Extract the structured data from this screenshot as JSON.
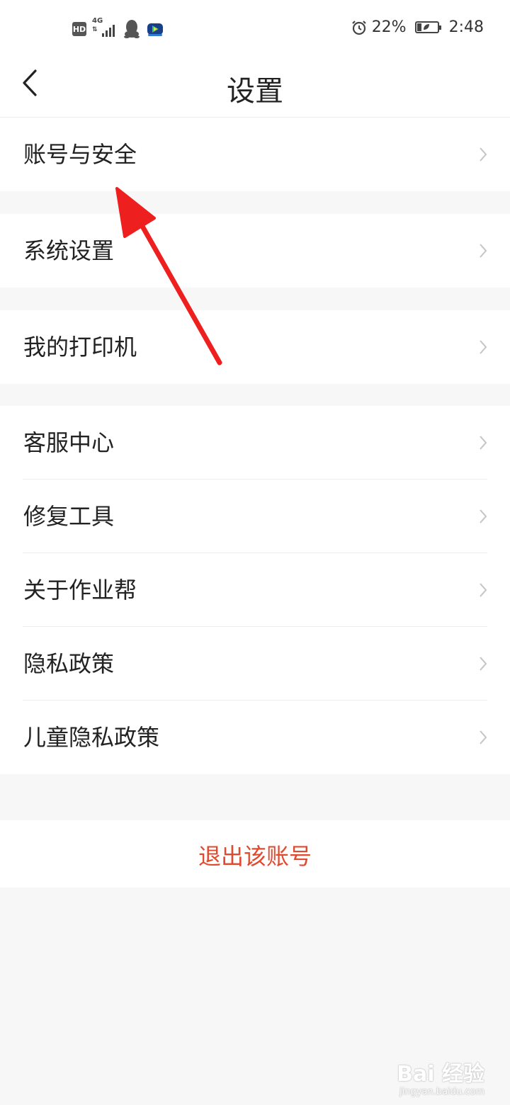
{
  "status_bar": {
    "hd": "HD",
    "network": "4G",
    "network_arrows": "⇅",
    "battery_percent": "22%",
    "time": "2:48",
    "battery_level": 0.22,
    "icons": [
      "alarm-icon",
      "battery-saver-icon",
      "qq-icon",
      "video-app-icon"
    ]
  },
  "header": {
    "title": "设置",
    "back_icon": "chevron-left-icon"
  },
  "groups": {
    "account": {
      "label": "账号与安全"
    },
    "system": {
      "label": "系统设置"
    },
    "printer": {
      "label": "我的打印机"
    },
    "support": {
      "items": [
        {
          "label": "客服中心"
        },
        {
          "label": "修复工具"
        },
        {
          "label": "关于作业帮"
        },
        {
          "label": "隐私政策"
        },
        {
          "label": "儿童隐私政策"
        }
      ]
    }
  },
  "logout": {
    "label": "退出该账号",
    "color": "#e04a2f"
  },
  "annotation": {
    "color": "#ee1f1f"
  },
  "watermark": {
    "logo": "Bai 经验",
    "sub": "jingyan.baidu.com"
  }
}
